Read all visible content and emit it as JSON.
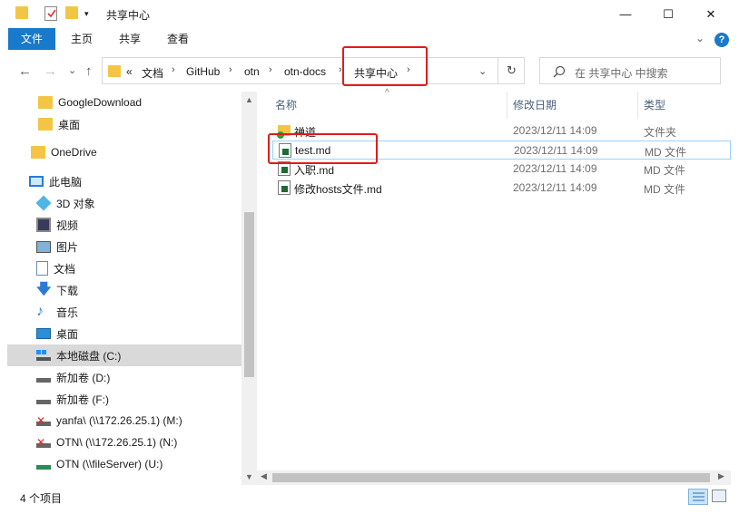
{
  "window": {
    "title": "共享中心",
    "minimize_glyph": "—",
    "maximize_glyph": "☐",
    "close_glyph": "✕"
  },
  "ribbon": {
    "tabs": [
      {
        "label": "文件",
        "active": true
      },
      {
        "label": "主页",
        "active": false
      },
      {
        "label": "共享",
        "active": false
      },
      {
        "label": "查看",
        "active": false
      }
    ],
    "expand_glyph": "⌄",
    "help_glyph": "?"
  },
  "nav": {
    "back_glyph": "←",
    "forward_glyph": "→",
    "history_glyph": "⌄",
    "up_glyph": "↑"
  },
  "address": {
    "overflow": "«",
    "crumbs": [
      "文档",
      "GitHub",
      "otn",
      "otn-docs",
      "共享中心"
    ],
    "separator": "›",
    "dropdown_glyph": "⌄",
    "refresh_glyph": "↻"
  },
  "search": {
    "placeholder": "在 共享中心 中搜索",
    "icon": "search-icon"
  },
  "sidebar": {
    "items": [
      {
        "label": "GoogleDownload",
        "icon": "folder-icon"
      },
      {
        "label": "桌面",
        "icon": "folder-icon"
      },
      {
        "label": "OneDrive",
        "icon": "folder-icon"
      },
      {
        "label": "此电脑",
        "icon": "computer-icon"
      },
      {
        "label": "3D 对象",
        "icon": "3d-objects-icon"
      },
      {
        "label": "视频",
        "icon": "video-icon"
      },
      {
        "label": "图片",
        "icon": "pictures-icon"
      },
      {
        "label": "文档",
        "icon": "documents-icon"
      },
      {
        "label": "下载",
        "icon": "download-icon"
      },
      {
        "label": "音乐",
        "icon": "music-icon"
      },
      {
        "label": "桌面",
        "icon": "desktop-icon"
      },
      {
        "label": "本地磁盘 (C:)",
        "icon": "system-drive-icon"
      },
      {
        "label": "新加卷 (D:)",
        "icon": "drive-icon"
      },
      {
        "label": "新加卷 (F:)",
        "icon": "drive-icon"
      },
      {
        "label": "yanfa\\ (\\\\172.26.25.1) (M:)",
        "icon": "network-drive-disconnected-icon"
      },
      {
        "label": "OTN\\ (\\\\172.26.25.1) (N:)",
        "icon": "network-drive-disconnected-icon"
      },
      {
        "label": "OTN (\\\\fileServer) (U:)",
        "icon": "network-drive-icon"
      }
    ]
  },
  "filelist": {
    "columns": {
      "name": "名称",
      "date": "修改日期",
      "type": "类型"
    },
    "sort_glyph": "^",
    "rows": [
      {
        "name": "禅道",
        "date": "2023/12/11 14:09",
        "type": "文件夹",
        "icon": "folder-synced-icon"
      },
      {
        "name": "test.md",
        "date": "2023/12/11 14:09",
        "type": "MD 文件",
        "icon": "markdown-file-icon"
      },
      {
        "name": "入职.md",
        "date": "2023/12/11 14:09",
        "type": "MD 文件",
        "icon": "markdown-file-icon"
      },
      {
        "name": "修改hosts文件.md",
        "date": "2023/12/11 14:09",
        "type": "MD 文件",
        "icon": "markdown-file-icon"
      }
    ]
  },
  "statusbar": {
    "count_text": "4 个项目"
  },
  "colors": {
    "accent": "#1979ca",
    "annotation": "#e21b1b",
    "selection": "#d9d9d9",
    "folder": "#f3c544"
  }
}
